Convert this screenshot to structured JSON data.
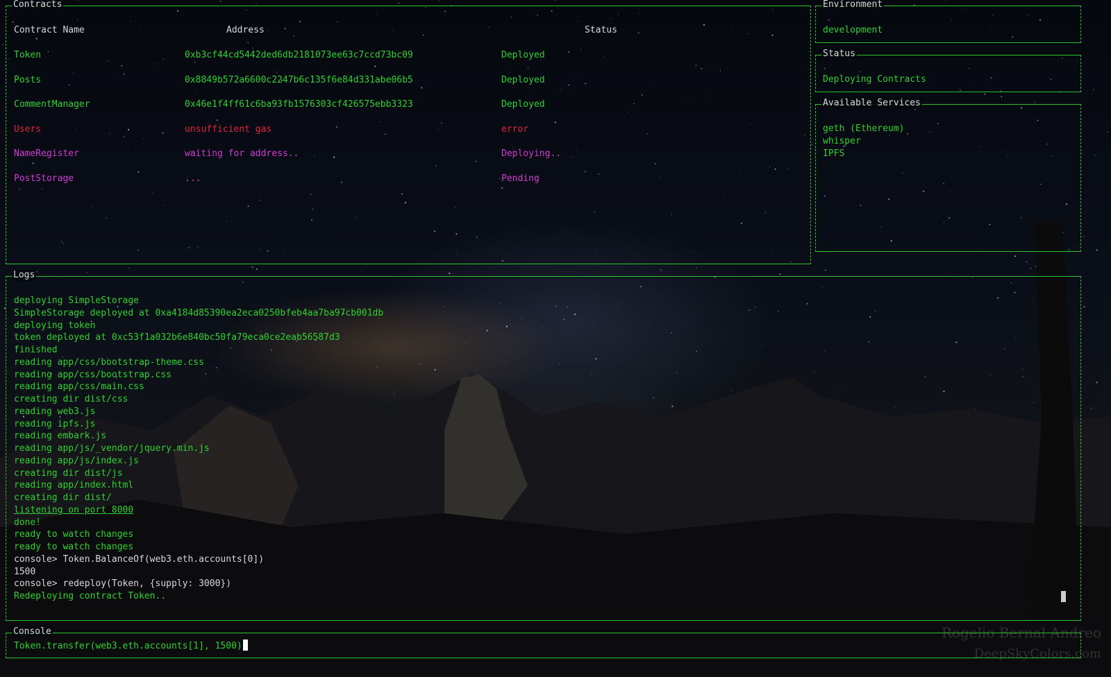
{
  "contracts": {
    "title": "Contracts",
    "columns": [
      "Contract Name",
      "Address",
      "Status"
    ],
    "rows": [
      {
        "name": "Token",
        "address": "0xb3cf44cd5442ded6db2181073ee63c7ccd73bc09",
        "status": "Deployed",
        "color": "#2fd22f"
      },
      {
        "name": "Posts",
        "address": "0x8849b572a6600c2247b6c135f6e84d331abe06b5",
        "status": "Deployed",
        "color": "#2fd22f"
      },
      {
        "name": "CommentManager",
        "address": "0x46e1f4ff61c6ba93fb1576303cf426575ebb3323",
        "status": "Deployed",
        "color": "#2fd22f"
      },
      {
        "name": "Users",
        "address": "unsufficient gas",
        "status": "error",
        "color": "#e0263e"
      },
      {
        "name": "NameRegister",
        "address": "waiting for address..",
        "status": "Deploying..",
        "color": "#d23ad2"
      },
      {
        "name": "PostStorage",
        "address": "...",
        "status": "Pending",
        "color": "#d23ad2"
      }
    ]
  },
  "environment": {
    "title": "Environment",
    "value": "development"
  },
  "status": {
    "title": "Status",
    "value": "Deploying Contracts"
  },
  "services": {
    "title": "Available Services",
    "items": [
      "geth (Ethereum)",
      "whisper",
      "IPFS"
    ]
  },
  "logs": {
    "title": "Logs",
    "lines": [
      {
        "text": "deploying SimpleStorage",
        "style": "green"
      },
      {
        "text": "SimpleStorage deployed at 0xa4184d85390ea2eca0250bfeb4aa7ba97cb001db",
        "style": "green"
      },
      {
        "text": "deploying token",
        "style": "green"
      },
      {
        "text": "token deployed at 0xc53f1a032b6e840bc50fa79eca0ce2eab56587d3",
        "style": "green"
      },
      {
        "text": "finished",
        "style": "green"
      },
      {
        "text": "reading app/css/bootstrap-theme.css",
        "style": "green"
      },
      {
        "text": "reading app/css/bootstrap.css",
        "style": "green"
      },
      {
        "text": "reading app/css/main.css",
        "style": "green"
      },
      {
        "text": "creating dir dist/css",
        "style": "green"
      },
      {
        "text": "reading web3.js",
        "style": "green"
      },
      {
        "text": "reading ipfs.js",
        "style": "green"
      },
      {
        "text": "reading embark.js",
        "style": "green"
      },
      {
        "text": "reading app/js/_vendor/jquery.min.js",
        "style": "green"
      },
      {
        "text": "reading app/js/index.js",
        "style": "green"
      },
      {
        "text": "creating dir dist/js",
        "style": "green"
      },
      {
        "text": "reading app/index.html",
        "style": "green"
      },
      {
        "text": "creating dir dist/",
        "style": "green"
      },
      {
        "text": "listening on port 8000",
        "style": "green-underline"
      },
      {
        "text": "done!",
        "style": "green"
      },
      {
        "text": "ready to watch changes",
        "style": "green"
      },
      {
        "text": "ready to watch changes",
        "style": "green"
      },
      {
        "text": "console> Token.BalanceOf(web3.eth.accounts[0])",
        "style": "white"
      },
      {
        "text": "1500",
        "style": "white"
      },
      {
        "text": "console> redeploy(Token, {supply: 3000})",
        "style": "white"
      },
      {
        "text": "Redeploying contract Token..",
        "style": "green"
      }
    ]
  },
  "console": {
    "title": "Console",
    "input": "Token.transfer(web3.eth.accounts[1], 1500)"
  },
  "watermark": {
    "line1": "Rogelio Bernal Andreo",
    "line2": "DeepSkyColors.com"
  },
  "colors": {
    "border": "#2bc52b",
    "green": "#2fd22f",
    "red": "#e0263e",
    "magenta": "#d23ad2",
    "white": "#d8d8d8"
  }
}
